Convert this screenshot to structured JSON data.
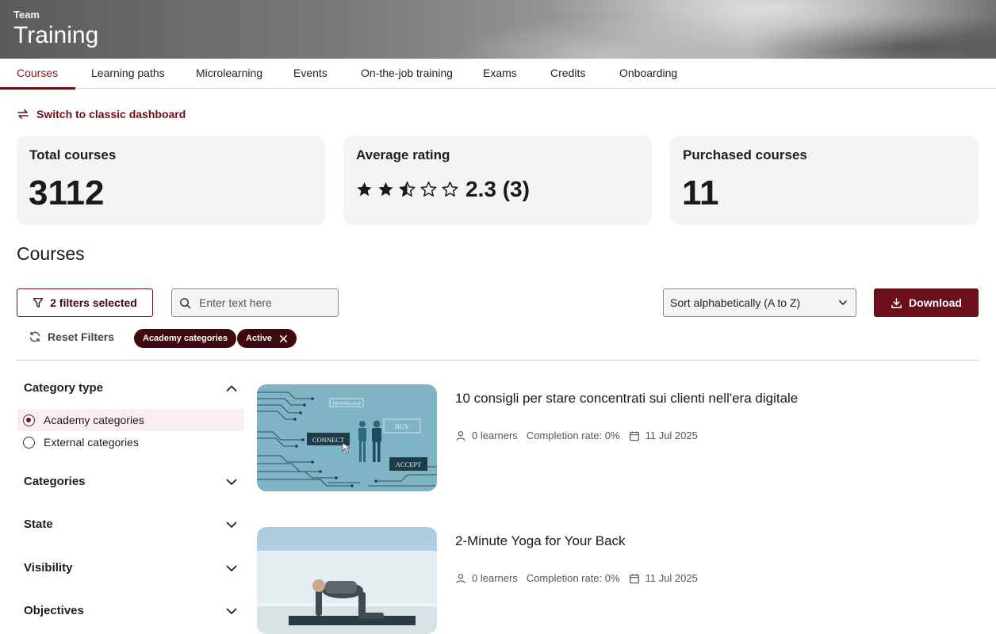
{
  "header": {
    "eyebrow": "Team",
    "title": "Training"
  },
  "tabs": [
    {
      "label": "Courses",
      "active": true
    },
    {
      "label": "Learning paths"
    },
    {
      "label": "Microlearning"
    },
    {
      "label": "Events"
    },
    {
      "label": "On-the-job training"
    },
    {
      "label": "Exams"
    },
    {
      "label": "Credits"
    },
    {
      "label": "Onboarding"
    }
  ],
  "switch_link": {
    "label": "Switch to classic dashboard",
    "icon": "swap-arrows-icon"
  },
  "stats": {
    "total": {
      "label": "Total courses",
      "value": "3112"
    },
    "rating": {
      "label": "Average rating",
      "value": "2.3 (3)",
      "stars": 2.5,
      "max_stars": 5
    },
    "purchased": {
      "label": "Purchased courses",
      "value": "11"
    }
  },
  "section": {
    "title": "Courses"
  },
  "controls": {
    "filters_label": "2 filters selected",
    "search_placeholder": "Enter text here",
    "sort_value": "Sort alphabetically (A to Z)",
    "download_label": "Download",
    "reset_label": "Reset Filters"
  },
  "chips": [
    {
      "label": "Academy categories"
    },
    {
      "label": "Active",
      "removable": true
    }
  ],
  "sidebar": {
    "category_type": {
      "title": "Category type",
      "options": [
        {
          "label": "Academy categories",
          "selected": true
        },
        {
          "label": "External categories",
          "selected": false
        }
      ]
    },
    "facets": [
      {
        "title": "Categories"
      },
      {
        "title": "State"
      },
      {
        "title": "Visibility"
      },
      {
        "title": "Objectives"
      }
    ]
  },
  "courses": [
    {
      "title": "10 consigli per stare concentrati sui clienti nell'era digitale",
      "learners": "0 learners",
      "completion": "Completion rate: 0%",
      "date": "11 Jul 2025",
      "thumb_words": [
        "DOWNLOAD",
        "CONNECT",
        "BUY",
        "ACCEPT"
      ]
    },
    {
      "title": "2-Minute Yoga for Your Back",
      "learners": "0 learners",
      "completion": "Completion rate: 0%",
      "date": "11 Jul 2025"
    }
  ],
  "colors": {
    "brand": "#6b0f1a",
    "chip": "#3d0a10",
    "card": "#f4f4f4"
  }
}
